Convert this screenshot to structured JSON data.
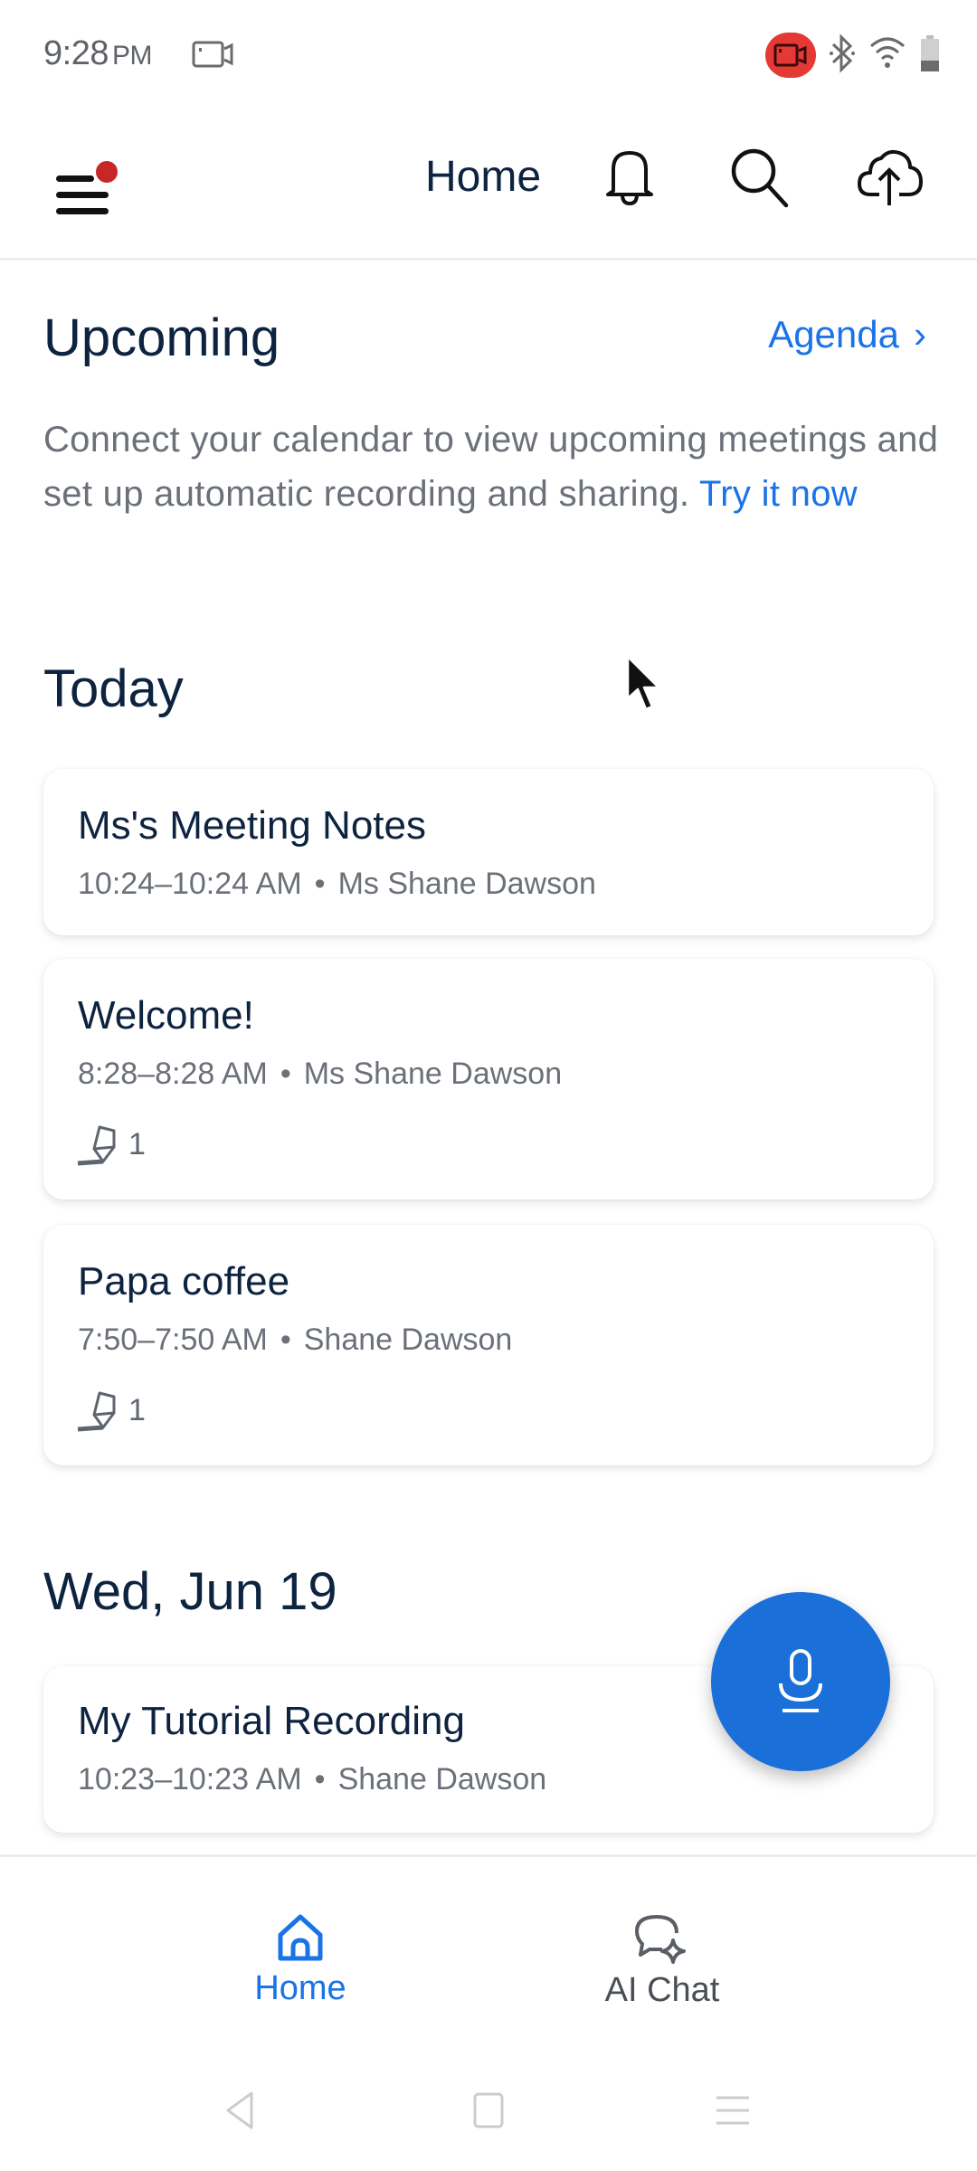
{
  "status_bar": {
    "time": "9:28",
    "ampm": "PM",
    "left_icon": "screen-record-icon",
    "right_icons": [
      "recording-badge-icon",
      "bluetooth-icon",
      "wifi-icon",
      "battery-icon"
    ]
  },
  "app_bar": {
    "title": "Home",
    "menu_icon": "hamburger-menu-icon",
    "has_notification_dot": true,
    "actions": [
      "bell-icon",
      "search-icon",
      "cloud-upload-icon"
    ]
  },
  "upcoming": {
    "title": "Upcoming",
    "agenda_label": "Agenda",
    "agenda_chevron": "›",
    "description": "Connect your calendar to view upcoming meetings and set up automatic recording and sharing.",
    "cta_label": "Try it now"
  },
  "sections": [
    {
      "title": "Today",
      "items": [
        {
          "title": "Ms's Meeting Notes",
          "time": "10:24–10:24 AM",
          "owner": "Ms Shane Dawson",
          "highlights": null
        },
        {
          "title": "Welcome!",
          "time": "8:28–8:28 AM",
          "owner": "Ms Shane Dawson",
          "highlights": "1"
        },
        {
          "title": "Papa coffee",
          "time": "7:50–7:50 AM",
          "owner": "Shane Dawson",
          "highlights": "1"
        }
      ]
    },
    {
      "title": "Wed, Jun 19",
      "items": [
        {
          "title": "My Tutorial Recording",
          "time": "10:23–10:23 AM",
          "owner": "Shane Dawson",
          "highlights": null
        }
      ]
    }
  ],
  "separator": "•",
  "fab": {
    "icon": "microphone-icon"
  },
  "bottom_nav": {
    "items": [
      {
        "label": "Home",
        "icon": "home-icon",
        "active": true
      },
      {
        "label": "AI Chat",
        "icon": "ai-chat-icon",
        "active": false
      }
    ]
  },
  "system_nav": [
    "back-icon",
    "home-square-icon",
    "recents-menu-icon"
  ],
  "colors": {
    "accent": "#1a73e8",
    "fab": "#1a6fd8",
    "title": "#0d2340",
    "muted": "#6b7079",
    "notification_dot": "#c62828",
    "recording_badge": "#e53935"
  }
}
